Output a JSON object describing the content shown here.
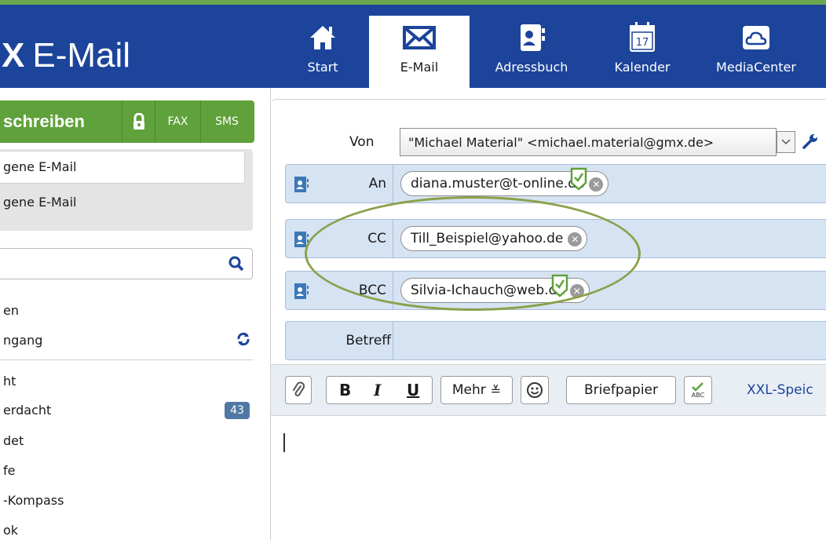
{
  "header": {
    "brand_prefix": "X",
    "brand_title": "E-Mail",
    "tabs": [
      {
        "label": "Start",
        "icon": "home-icon"
      },
      {
        "label": "E-Mail",
        "icon": "envelope-icon",
        "active": true
      },
      {
        "label": "Adressbuch",
        "icon": "address-book-icon"
      },
      {
        "label": "Kalender",
        "icon": "calendar-icon",
        "day": "17"
      },
      {
        "label": "MediaCenter",
        "icon": "cloud-icon"
      }
    ]
  },
  "sidebar": {
    "compose_label": "schreiben",
    "fax_label": "FAX",
    "sms_label": "SMS",
    "folders": [
      "gene E-Mail",
      "gene E-Mail"
    ],
    "items": [
      "en",
      "ngang",
      "ht",
      "erdacht",
      "det",
      "fe",
      "-Kompass",
      "ok"
    ],
    "badge": "43"
  },
  "compose": {
    "from_label": "Von",
    "from_value": "\"Michael Material\" <michael.material@gmx.de>",
    "to_label": "An",
    "to_value": "diana.muster@t-online.de",
    "cc_label": "CC",
    "cc_value": "Till_Beispiel@yahoo.de",
    "bcc_label": "BCC",
    "bcc_value": "Silvia-Ichauch@web.de",
    "subject_label": "Betreff"
  },
  "toolbar": {
    "bold": "B",
    "italic": "I",
    "underline": "U",
    "more": "Mehr",
    "stationery": "Briefpapier",
    "xxl": "XXL-Speic"
  },
  "colors": {
    "header_bg": "#1c449b",
    "compose_green": "#5fa13a",
    "row_blue": "#d6e3f3",
    "ellipse": "#8aa14a"
  }
}
